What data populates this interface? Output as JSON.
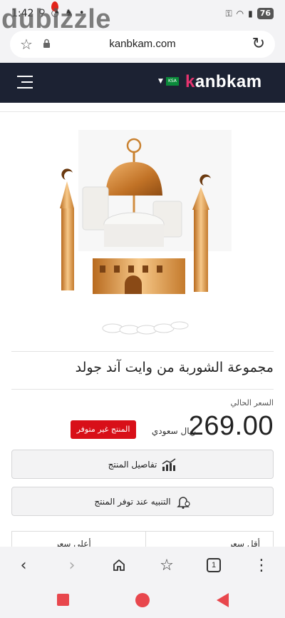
{
  "status_bar": {
    "time": "1:42",
    "battery": "76",
    "watermark": "dubizzle"
  },
  "browser": {
    "url": "kanbkam.com",
    "tab_count": "1"
  },
  "site": {
    "logo": "kanbkam",
    "flag_text": "KSA"
  },
  "product": {
    "title": "مجموعة الشوربة من وايت آند جولد",
    "price_label": "السعر الحالي",
    "price": "269.00",
    "currency": "ريال سعودي",
    "stock_badge": "المنتج غير متوفر"
  },
  "buttons": {
    "details": "تفاصيل المنتج",
    "notify": "التنبيه عند توفر المنتج"
  },
  "tabs": {
    "lowest": "أقل سعر",
    "highest": "أعلى سعر"
  },
  "colors": {
    "header_bg": "#1c2233",
    "badge_red": "#d80f18",
    "logo_accent": "#e6336f",
    "system_nav": "#e8474d"
  }
}
